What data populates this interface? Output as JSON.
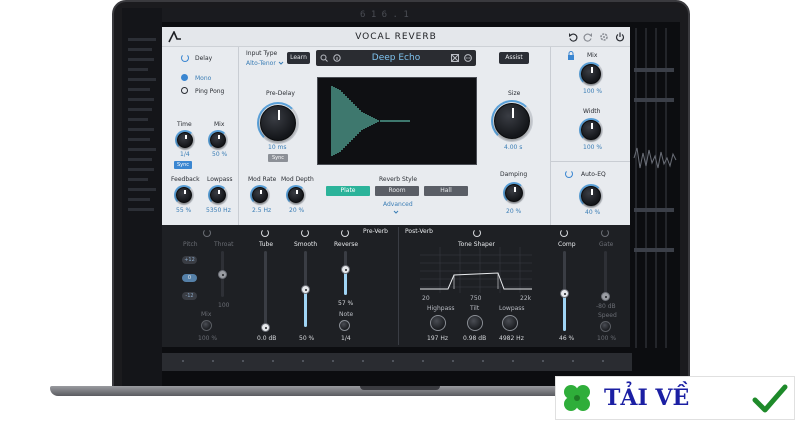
{
  "plugin": {
    "title": "VOCAL REVERB",
    "header": {
      "input_type_label": "Input Type",
      "input_type_value": "Alto-Tenor",
      "learn_label": "Learn",
      "preset_name": "Deep Echo",
      "assist_label": "Assist"
    },
    "delay": {
      "label": "Delay",
      "mode_options": [
        "Mono",
        "Ping Pong"
      ],
      "time_label": "Time",
      "time_value": "1/4",
      "sync_label": "Sync",
      "mix_label": "Mix",
      "mix_value": "50 %",
      "feedback_label": "Feedback",
      "feedback_value": "55 %",
      "lowpass_label": "Lowpass",
      "lowpass_value": "5350 Hz"
    },
    "reverb": {
      "predelay_label": "Pre-Delay",
      "predelay_value": "10 ms",
      "predelay_sync_label": "Sync",
      "mod_rate_label": "Mod Rate",
      "mod_rate_value": "2.5 Hz",
      "mod_depth_label": "Mod Depth",
      "mod_depth_value": "20 %",
      "style_label": "Reverb Style",
      "styles": [
        "Plate",
        "Room",
        "Hall"
      ],
      "active_style": "Plate",
      "advanced_label": "Advanced",
      "size_label": "Size",
      "size_value": "4.00 s",
      "damping_label": "Damping",
      "damping_value": "20 %"
    },
    "output": {
      "mix_label": "Mix",
      "mix_value": "100 %",
      "width_label": "Width",
      "width_value": "100 %",
      "auto_eq_label": "Auto-EQ",
      "auto_eq_value": "40 %"
    },
    "pre_verb": {
      "section_label": "Pre-Verb",
      "pitch_label": "Pitch",
      "pitch_buttons": [
        "+12",
        "0",
        "-12"
      ],
      "throat_label": "Throat",
      "throat_value": "100",
      "pitch_mix_label": "Mix",
      "pitch_mix_value": "100 %",
      "tube_label": "Tube",
      "tube_value": "0.0 dB",
      "smooth_label": "Smooth",
      "smooth_value": "50 %",
      "reverse_label": "Reverse",
      "reverse_value": "57 %",
      "note_label": "Note",
      "note_value": "1/4"
    },
    "post_verb": {
      "section_label": "Post-Verb",
      "tone_shaper_label": "Tone Shaper",
      "axis_ticks": [
        "20",
        "750",
        "22k"
      ],
      "highpass_label": "Highpass",
      "highpass_value": "197 Hz",
      "tilt_label": "Tilt",
      "tilt_value": "0.98 dB",
      "lowpass_label": "Lowpass",
      "lowpass_value": "4982 Hz",
      "comp_label": "Comp",
      "comp_value": "46 %",
      "gate_label": "Gate",
      "gate_value": "-80 dB",
      "speed_label": "Speed",
      "speed_value": "100 %"
    }
  },
  "daw_background": {
    "readout": "6 1 6 . 1"
  },
  "watermark": {
    "text": "TẢI VỀ"
  },
  "colors": {
    "accent_blue": "#3a86d1",
    "teal": "#2bb39a",
    "waveform": "#6ee0c8",
    "panel_light": "#e8ebef",
    "panel_dark": "#1e2024"
  },
  "icons": [
    "power-icon",
    "undo-icon",
    "redo-icon",
    "gear-icon",
    "lock-icon",
    "search-icon",
    "compare-icon",
    "more-icon",
    "clover-icon",
    "checkmark-icon"
  ]
}
